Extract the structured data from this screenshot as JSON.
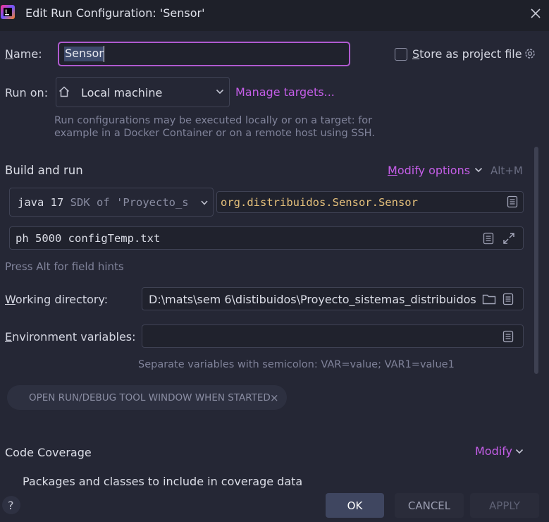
{
  "window": {
    "title": "Edit Run Configuration: 'Sensor'",
    "logo_text": "IJ"
  },
  "name_row": {
    "label_mnemonic": "N",
    "label_rest": "ame:",
    "value": "Sensor",
    "store_label_mnemonic": "S",
    "store_label_rest": "tore as project file",
    "store_checked": false
  },
  "run_on": {
    "label": "Run on:",
    "target": "Local machine",
    "manage_link": "Manage targets...",
    "hint_line1": "Run configurations may be executed locally or on a target: for",
    "hint_line2": "example in a Docker Container or on a remote host using SSH."
  },
  "build_run": {
    "heading": "Build and run",
    "modify_mnemonic": "M",
    "modify_rest": "odify options",
    "shortcut": "Alt+M",
    "sdk_bold": "java 17",
    "sdk_rest": "SDK of 'Proyecto_s",
    "main_class": "org.distribuidos.Sensor.Sensor",
    "program_args": "ph 5000 configTemp.txt",
    "field_hint": "Press Alt for field hints"
  },
  "working_dir": {
    "label_mnemonic": "W",
    "label_rest": "orking directory:",
    "value": "D:\\mats\\sem 6\\distibuidos\\Proyecto_sistemas_distribuidos"
  },
  "env_vars": {
    "label_mnemonic": "E",
    "label_rest": "nvironment variables:",
    "value": "",
    "hint": "Separate variables with semicolon: VAR=value; VAR1=value1"
  },
  "chip": {
    "label": "OPEN RUN/DEBUG TOOL WINDOW WHEN STARTED",
    "close": "×"
  },
  "coverage": {
    "heading": "Code Coverage",
    "modify": "Modify",
    "packages": "Packages and classes to include in coverage data"
  },
  "footer": {
    "help": "?",
    "ok": "OK",
    "cancel": "CANCEL",
    "apply": "APPLY"
  },
  "colors": {
    "accent": "#c55ee8",
    "background": "#252735",
    "titlebar": "#1e2029",
    "field": "#20222d",
    "class_text": "#e5c07b"
  }
}
